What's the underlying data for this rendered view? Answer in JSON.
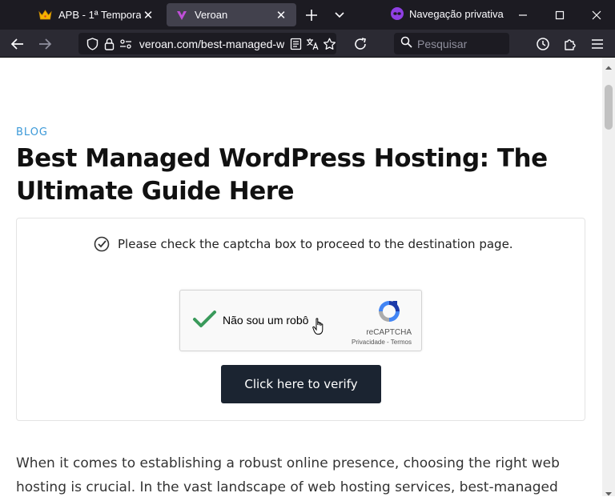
{
  "browser": {
    "tabs": [
      {
        "title": "APB - 1ª Temporada",
        "close": "✕"
      },
      {
        "title": "Veroan",
        "close": "✕"
      }
    ],
    "private_label": "Navegação privativa",
    "url_display": "veroan.com/best-managed-w",
    "search_placeholder": "Pesquisar",
    "colors": {
      "tabbar_bg": "#1c1b22",
      "navbar_bg": "#2b2a33",
      "active_tab_bg": "#42414d",
      "private_accent": "#8f3fe4"
    }
  },
  "article": {
    "category": "BLOG",
    "title": "Best Managed WordPress Hosting: The Ultimate Guide Here",
    "notice": "Please check the captcha box to proceed to the destination page.",
    "recaptcha": {
      "label": "Não sou um robô",
      "brand": "reCAPTCHA",
      "links": "Privacidade - Termos",
      "checked": true
    },
    "verify_button": "Click here to verify",
    "paragraph": "When it comes to establishing a robust online presence, choosing the right web hosting is crucial. In the vast landscape of web hosting services, best-managed",
    "colors": {
      "category": "#3b99d8",
      "button_bg": "#1b2431",
      "check_green": "#3a9a5b"
    }
  }
}
